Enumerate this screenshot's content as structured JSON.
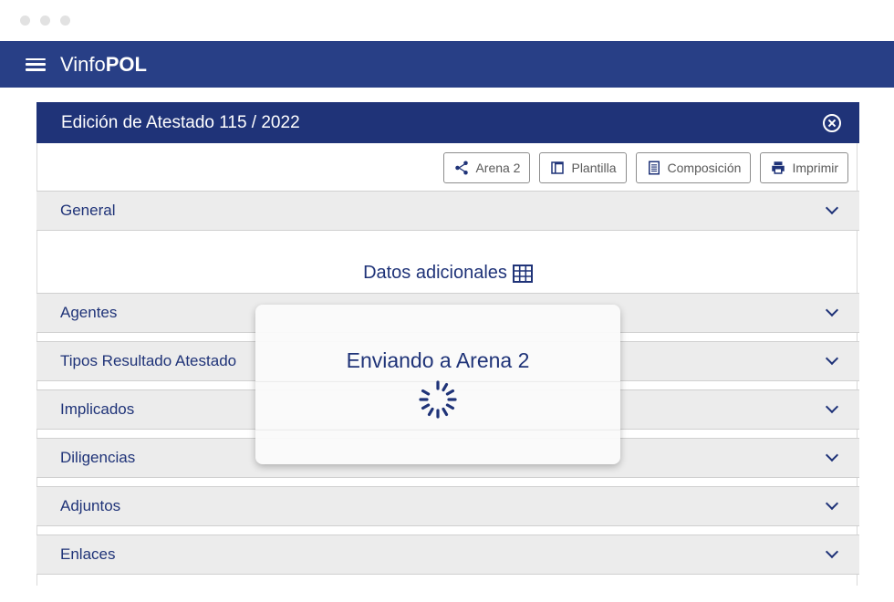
{
  "app": {
    "brand_prefix": "Vinfo",
    "brand_suffix": "POL"
  },
  "panel": {
    "title": "Edición de Atestado 115 / 2022"
  },
  "toolbar": {
    "arena_label": "Arena 2",
    "plantilla_label": "Plantilla",
    "composicion_label": "Composición",
    "imprimir_label": "Imprimir"
  },
  "sections": {
    "general": "General",
    "datos_adicionales": "Datos adicionales",
    "agentes": "Agentes",
    "tipos_resultado": "Tipos Resultado Atestado",
    "implicados": "Implicados",
    "diligencias": "Diligencias",
    "adjuntos": "Adjuntos",
    "enlaces": "Enlaces"
  },
  "modal": {
    "title": "Enviando a Arena 2"
  },
  "colors": {
    "appbar": "#283f86",
    "header": "#1f3378",
    "section_bg": "#ececec",
    "accent_text": "#1f3378"
  },
  "icons": [
    "menu-icon",
    "close-icon",
    "share-icon",
    "template-icon",
    "document-icon",
    "print-icon",
    "table-icon",
    "chevron-down-icon",
    "spinner-icon"
  ]
}
